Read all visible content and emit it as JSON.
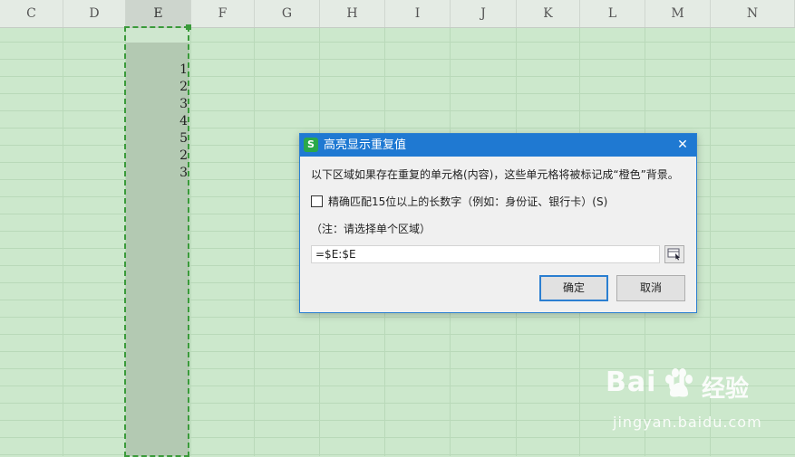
{
  "columns": [
    "C",
    "D",
    "E",
    "F",
    "G",
    "H",
    "I",
    "J",
    "K",
    "L",
    "M",
    "N"
  ],
  "selected_column": "E",
  "column_e_values": [
    "1",
    "2",
    "3",
    "4",
    "5",
    "2",
    "3"
  ],
  "dialog": {
    "title": "高亮显示重复值",
    "app_icon_letter": "S",
    "close_glyph": "✕",
    "description": "以下区域如果存在重复的单元格(内容)，这些单元格将被标记成“橙色”背景。",
    "checkbox_label": "精确匹配15位以上的长数字（例如：身份证、银行卡）(S)",
    "checkbox_checked": false,
    "note": "（注：请选择单个区域）",
    "range_value": "=$E:$E",
    "ok_label": "确定",
    "cancel_label": "取消"
  },
  "watermark": {
    "logo_text": "Bai  u",
    "chinese_text": "经验",
    "url": "jingyan.baidu.com"
  },
  "colors": {
    "sheet_background": "#cce8cc",
    "selection_fill": "#b3c9b2",
    "marquee": "#3a9a3a",
    "dialog_titlebar": "#1f79d2"
  }
}
